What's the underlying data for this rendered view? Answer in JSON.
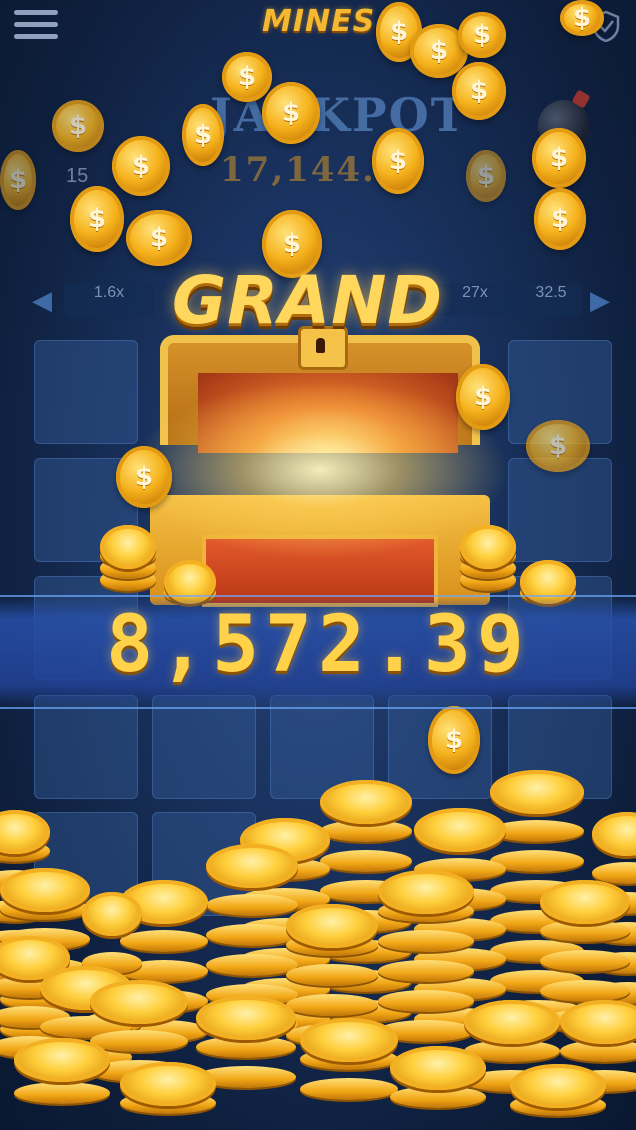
{
  "header": {
    "menu_icon": "hamburger-menu-icon",
    "logo_text": "MINES",
    "shield_icon": "shield-check-icon"
  },
  "jackpot": {
    "label": "JACKPOT",
    "value": "17,144."
  },
  "level_number": "15",
  "multipliers": [
    "1.6x",
    "27x",
    "32.5"
  ],
  "win": {
    "title": "GRAND",
    "amount": "8,572.39"
  },
  "coin_symbol": "$",
  "colors": {
    "gold": "#ffd24a",
    "banner_blue": "#2a4f9c",
    "tile_blue": "#345c96",
    "background": "#10213f"
  }
}
